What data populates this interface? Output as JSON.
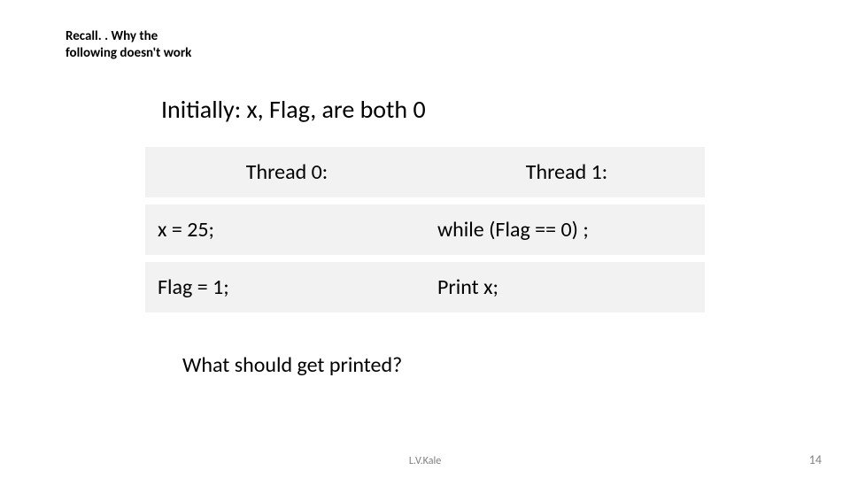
{
  "title_line1": "Recall. . Why the",
  "title_line2": "following doesn't work",
  "initial": "Initially: x, Flag, are both 0",
  "thread0_header": "Thread 0:",
  "thread1_header": "Thread 1:",
  "thread0_row1": "x = 25;",
  "thread1_row1": "while (Flag == 0) ;",
  "thread0_row2": "Flag = 1;",
  "thread1_row2": "Print x;",
  "question": "What should get printed?",
  "footer_center": "L.V.Kale",
  "footer_right": "14"
}
